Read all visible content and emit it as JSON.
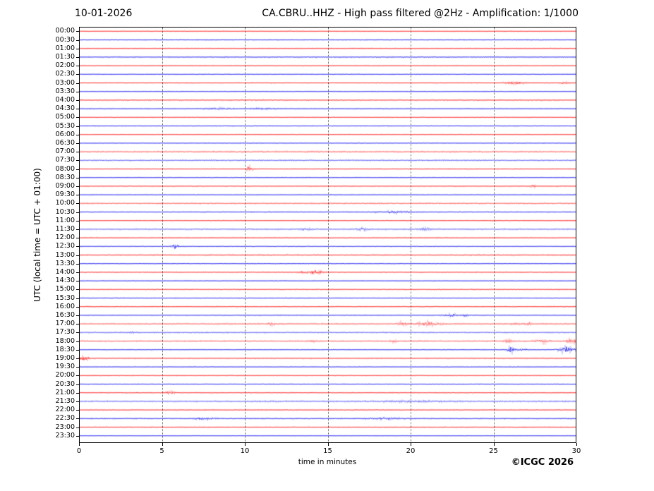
{
  "header": {
    "date": "10-01-2026",
    "title": "CA.CBRU..HHZ - High pass filtered @2Hz - Amplification: 1/1000"
  },
  "footer": {
    "copyright": "©ICGC 2026"
  },
  "axes": {
    "x_label": "time in minutes",
    "y_label": "UTC (local time = UTC + 01:00)",
    "x_ticks": [
      0,
      5,
      10,
      15,
      20,
      25,
      30
    ],
    "x_range": [
      0,
      30
    ]
  },
  "colors": {
    "trace_red": "#ff0000",
    "trace_blue": "#0000ee",
    "grid": "#666666",
    "frame": "#000000"
  },
  "chart_data": {
    "type": "line",
    "subtype": "helicorder-dayplot",
    "station": "CA.CBRU..HHZ",
    "filter": "High pass filtered @2Hz",
    "amplification": "1/1000",
    "date": "10-01-2026",
    "minutes_per_row": 30,
    "event_format": "[minute, width_minutes, amplitude_px]",
    "rows": [
      {
        "t": "00:00",
        "c": "r",
        "n": 0.3,
        "e": []
      },
      {
        "t": "00:30",
        "c": "b",
        "n": 0.35,
        "e": []
      },
      {
        "t": "01:00",
        "c": "r",
        "n": 0.35,
        "e": []
      },
      {
        "t": "01:30",
        "c": "b",
        "n": 0.45,
        "e": []
      },
      {
        "t": "02:00",
        "c": "r",
        "n": 0.3,
        "e": []
      },
      {
        "t": "02:30",
        "c": "b",
        "n": 0.3,
        "e": []
      },
      {
        "t": "03:00",
        "c": "r",
        "n": 0.35,
        "e": [
          [
            26.3,
            0.9,
            1.1
          ],
          [
            29.3,
            0.4,
            1.1
          ]
        ]
      },
      {
        "t": "03:30",
        "c": "b",
        "n": 0.3,
        "e": []
      },
      {
        "t": "04:00",
        "c": "r",
        "n": 0.45,
        "e": []
      },
      {
        "t": "04:30",
        "c": "b",
        "n": 0.35,
        "e": [
          [
            8.6,
            1.4,
            0.7
          ],
          [
            11.1,
            0.9,
            0.7
          ]
        ]
      },
      {
        "t": "05:00",
        "c": "r",
        "n": 0.3,
        "e": []
      },
      {
        "t": "05:30",
        "c": "b",
        "n": 0.3,
        "e": []
      },
      {
        "t": "06:00",
        "c": "r",
        "n": 0.25,
        "e": []
      },
      {
        "t": "06:30",
        "c": "b",
        "n": 0.3,
        "e": []
      },
      {
        "t": "07:00",
        "c": "r",
        "n": 0.6,
        "e": []
      },
      {
        "t": "07:30",
        "c": "b",
        "n": 0.55,
        "e": []
      },
      {
        "t": "08:00",
        "c": "r",
        "n": 0.3,
        "e": [
          [
            10.3,
            0.3,
            2.2
          ]
        ]
      },
      {
        "t": "08:30",
        "c": "b",
        "n": 0.3,
        "e": []
      },
      {
        "t": "09:00",
        "c": "r",
        "n": 0.35,
        "e": [
          [
            27.4,
            0.22,
            1.5
          ]
        ]
      },
      {
        "t": "09:30",
        "c": "b",
        "n": 0.3,
        "e": []
      },
      {
        "t": "10:00",
        "c": "r",
        "n": 0.55,
        "e": []
      },
      {
        "t": "10:30",
        "c": "b",
        "n": 0.35,
        "e": [
          [
            19.0,
            1.6,
            1.0
          ]
        ]
      },
      {
        "t": "11:00",
        "c": "r",
        "n": 0.35,
        "e": []
      },
      {
        "t": "11:30",
        "c": "b",
        "n": 0.5,
        "e": [
          [
            13.7,
            0.35,
            1.2
          ],
          [
            17.1,
            0.5,
            1.4
          ],
          [
            20.9,
            0.5,
            0.9
          ]
        ]
      },
      {
        "t": "12:00",
        "c": "r",
        "n": 0.35,
        "e": []
      },
      {
        "t": "12:30",
        "c": "b",
        "n": 0.3,
        "e": [
          [
            5.8,
            0.3,
            2.6
          ]
        ]
      },
      {
        "t": "13:00",
        "c": "r",
        "n": 0.45,
        "e": []
      },
      {
        "t": "13:30",
        "c": "b",
        "n": 0.3,
        "e": []
      },
      {
        "t": "14:00",
        "c": "r",
        "n": 0.35,
        "e": [
          [
            13.4,
            0.45,
            1.4
          ],
          [
            14.3,
            0.7,
            1.6
          ]
        ]
      },
      {
        "t": "14:30",
        "c": "b",
        "n": 0.3,
        "e": []
      },
      {
        "t": "15:00",
        "c": "r",
        "n": 0.4,
        "e": []
      },
      {
        "t": "15:30",
        "c": "b",
        "n": 0.3,
        "e": []
      },
      {
        "t": "16:00",
        "c": "r",
        "n": 0.4,
        "e": []
      },
      {
        "t": "16:30",
        "c": "b",
        "n": 0.35,
        "e": [
          [
            22.4,
            0.6,
            1.5
          ],
          [
            23.3,
            0.4,
            0.9
          ]
        ]
      },
      {
        "t": "17:00",
        "c": "r",
        "n": 0.5,
        "e": [
          [
            11.6,
            0.3,
            1.5
          ],
          [
            19.5,
            0.45,
            1.6
          ],
          [
            21.0,
            1.0,
            2.0
          ],
          [
            26.3,
            0.35,
            1.0
          ],
          [
            27.1,
            0.3,
            1.0
          ]
        ]
      },
      {
        "t": "17:30",
        "c": "b",
        "n": 0.5,
        "e": [
          [
            3.1,
            0.4,
            0.8
          ]
        ]
      },
      {
        "t": "18:00",
        "c": "r",
        "n": 0.5,
        "e": [
          [
            14.1,
            0.3,
            1.0
          ],
          [
            19.0,
            0.4,
            1.0
          ],
          [
            25.9,
            0.35,
            1.5
          ],
          [
            28.0,
            0.55,
            1.5
          ],
          [
            29.7,
            0.5,
            2.0
          ]
        ]
      },
      {
        "t": "18:30",
        "c": "b",
        "n": 0.35,
        "e": [
          [
            26.0,
            0.25,
            3.2
          ],
          [
            26.6,
            0.8,
            0.9
          ],
          [
            29.4,
            0.7,
            3.5
          ]
        ]
      },
      {
        "t": "19:00",
        "c": "r",
        "n": 0.4,
        "e": [
          [
            0.3,
            0.45,
            2.4
          ]
        ]
      },
      {
        "t": "19:30",
        "c": "b",
        "n": 0.3,
        "e": []
      },
      {
        "t": "20:00",
        "c": "r",
        "n": 0.35,
        "e": []
      },
      {
        "t": "20:30",
        "c": "b",
        "n": 0.3,
        "e": []
      },
      {
        "t": "21:00",
        "c": "r",
        "n": 0.4,
        "e": [
          [
            5.5,
            0.45,
            1.4
          ]
        ]
      },
      {
        "t": "21:30",
        "c": "b",
        "n": 0.55,
        "e": [
          [
            20.0,
            2.5,
            0.7
          ]
        ]
      },
      {
        "t": "22:00",
        "c": "r",
        "n": 0.35,
        "e": []
      },
      {
        "t": "22:30",
        "c": "b",
        "n": 0.45,
        "e": [
          [
            7.5,
            1.0,
            0.8
          ],
          [
            18.5,
            1.5,
            0.8
          ]
        ]
      },
      {
        "t": "23:00",
        "c": "r",
        "n": 0.35,
        "e": []
      },
      {
        "t": "23:30",
        "c": "b",
        "n": 0.15,
        "e": []
      }
    ]
  }
}
